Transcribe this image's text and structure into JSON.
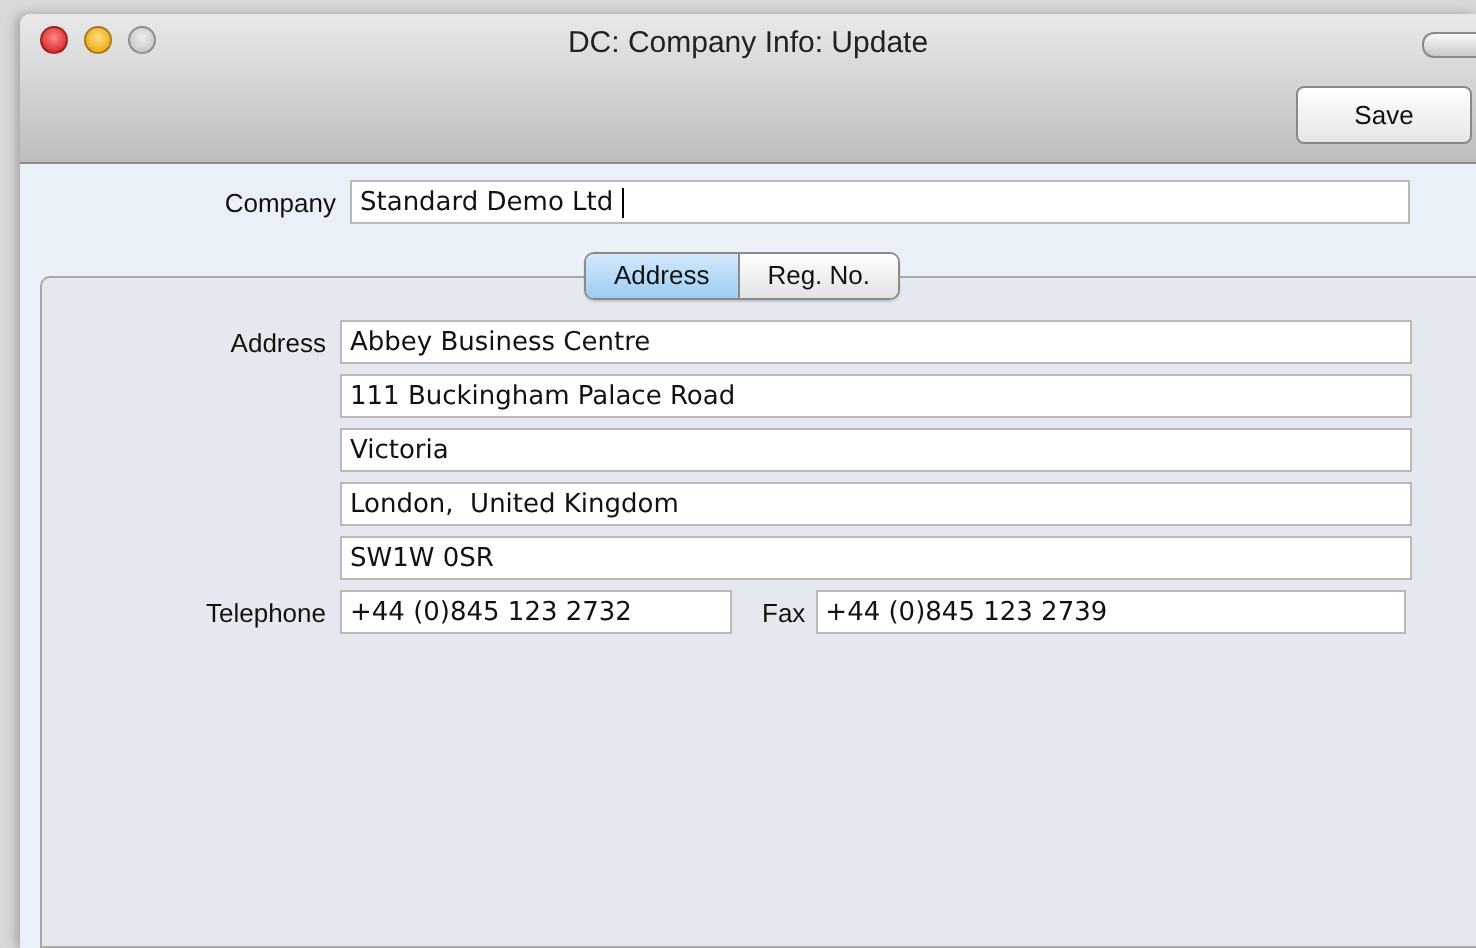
{
  "window": {
    "title": "DC: Company Info: Update"
  },
  "toolbar": {
    "buttons": [
      "Save"
    ]
  },
  "company": {
    "label": "Company",
    "value": "Standard Demo Ltd",
    "focused": true
  },
  "tabs": [
    {
      "label": "Address",
      "selected": true
    },
    {
      "label": "Reg. No.",
      "selected": false
    }
  ],
  "address": {
    "label": "Address",
    "lines": [
      "Abbey Business Centre",
      "111 Buckingham Palace Road",
      "Victoria",
      "London,  United Kingdom",
      "SW1W 0SR"
    ]
  },
  "telephone": {
    "label": "Telephone",
    "value": "+44 (0)845 123 2732"
  },
  "fax": {
    "label": "Fax",
    "value": "+44 (0)845 123 2739"
  }
}
